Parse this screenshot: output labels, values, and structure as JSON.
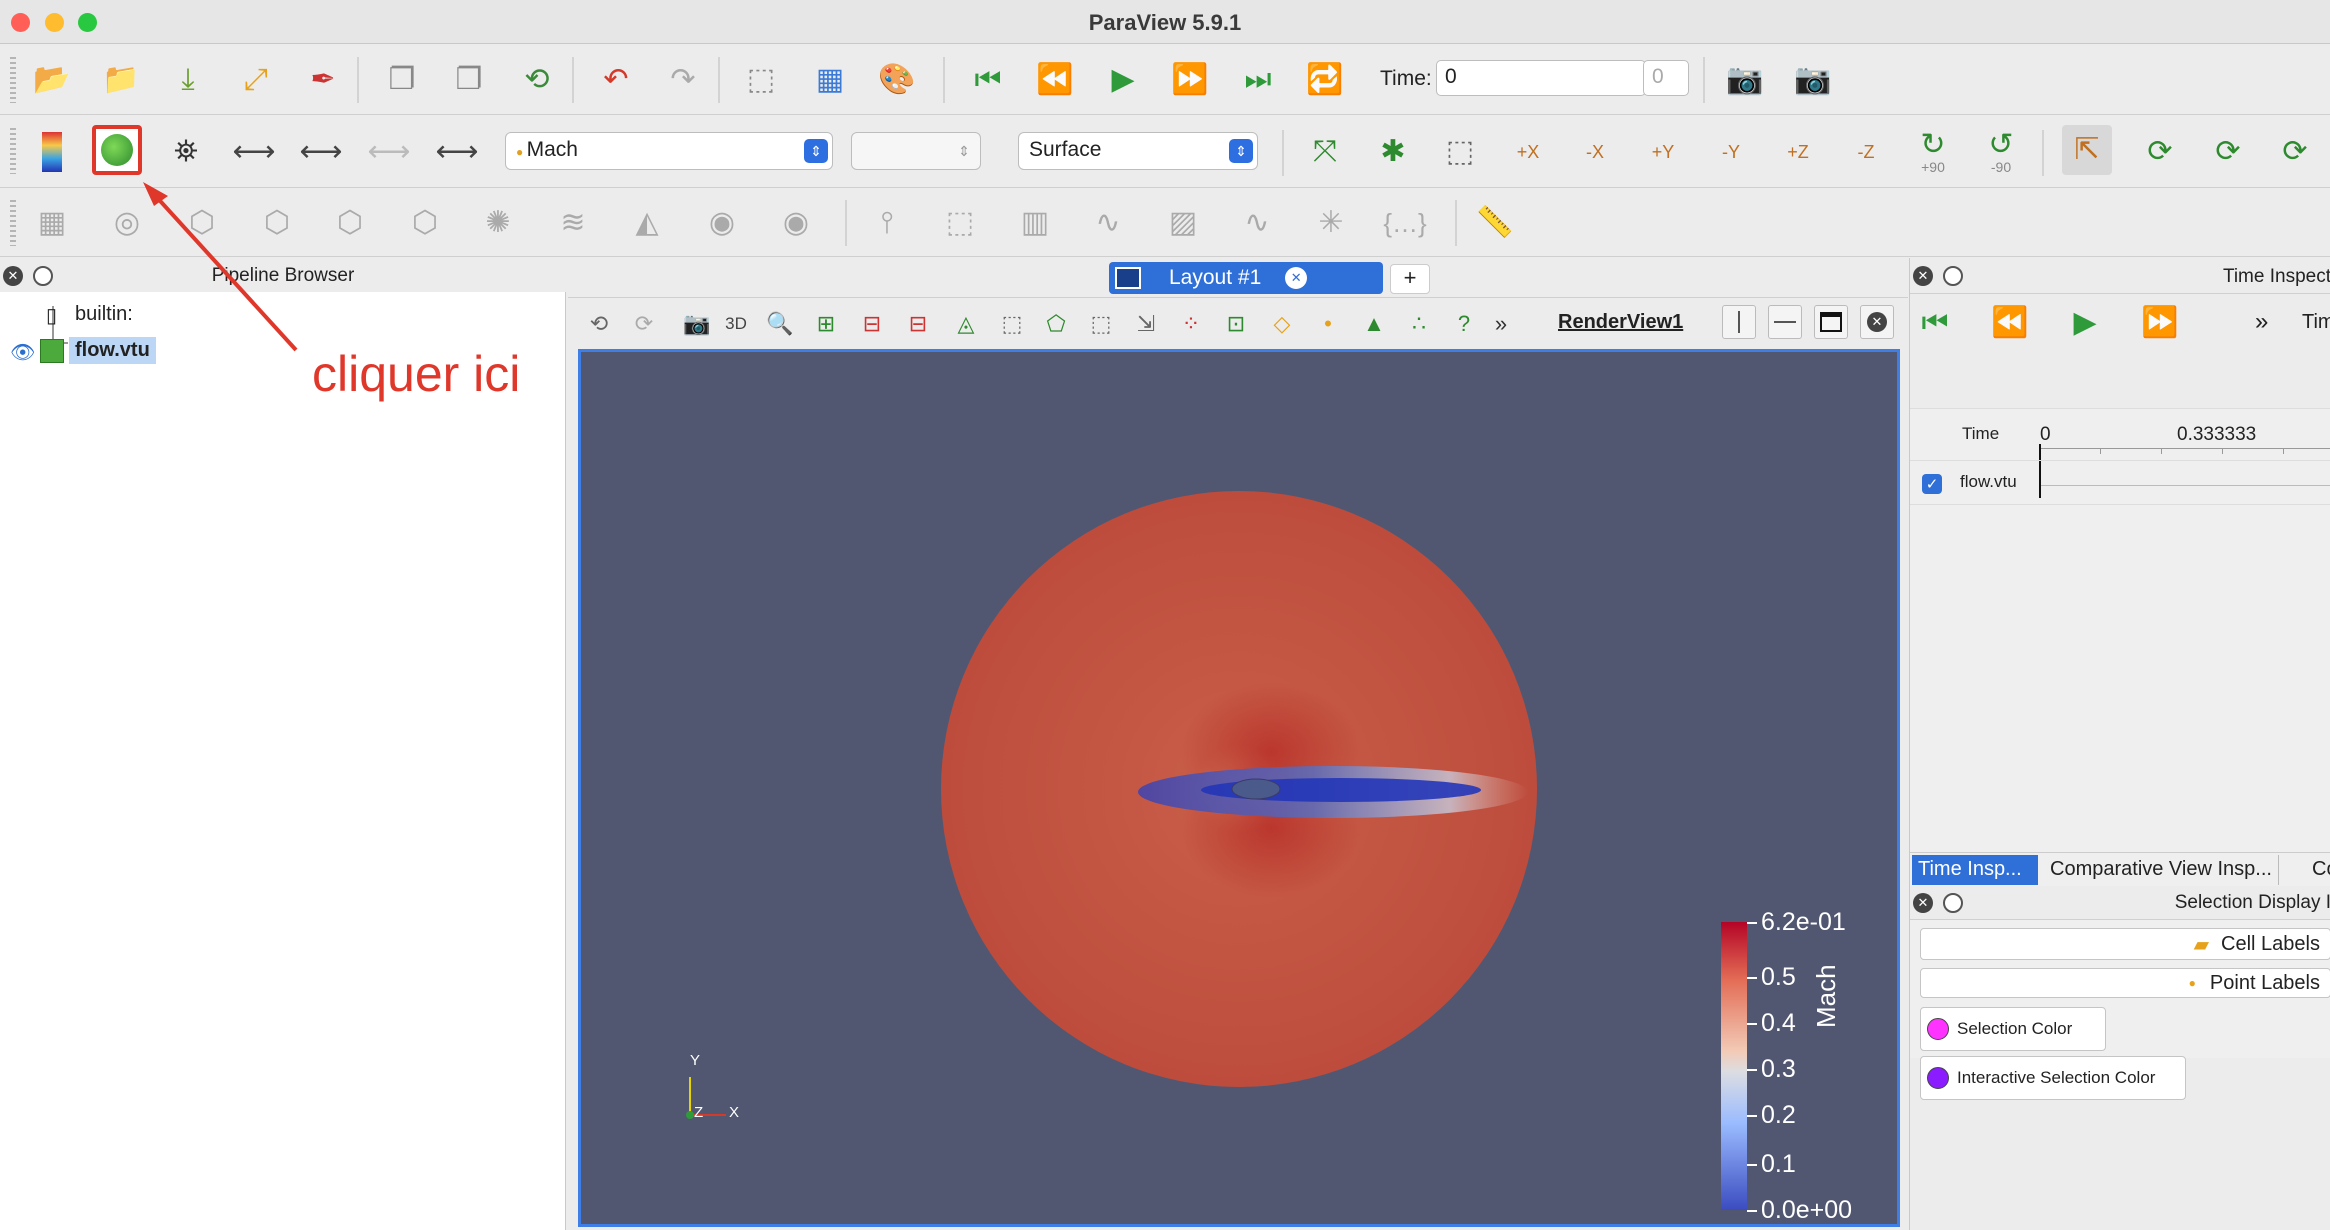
{
  "window": {
    "title": "ParaView 5.9.1"
  },
  "toolbar1": {
    "time_label": "Time:",
    "time_value": "0",
    "time_index": "0"
  },
  "toolbar2": {
    "array_select": "Mach",
    "component_select": "",
    "representation_select": "Surface",
    "cam_labels": [
      "+X",
      "-X",
      "+Y",
      "-Y",
      "+Z",
      "-Z"
    ],
    "rot_plus": "+90",
    "rot_minus": "-90"
  },
  "pipeline": {
    "title": "Pipeline Browser",
    "items": [
      {
        "label": "builtin:"
      },
      {
        "label": "flow.vtu"
      }
    ]
  },
  "annotation": {
    "text": "cliquer ici",
    "color": "#e0372b"
  },
  "layout": {
    "tab_label": "Layout #1",
    "add_label": "+",
    "view_name": "RenderView1",
    "btn_3d": "3D",
    "more": "»"
  },
  "render": {
    "background": "#525771",
    "axes": {
      "y": "Y",
      "z": "Z",
      "x": "X"
    },
    "colorbar": {
      "title": "Mach",
      "ticks": [
        "6.2e-01",
        "0.5",
        "0.4",
        "0.3",
        "0.2",
        "0.1",
        "0.0e+00"
      ]
    }
  },
  "time_inspector": {
    "title": "Time Inspect",
    "more": "»",
    "tim": "Tim",
    "time_header": "Time",
    "time_start": "0",
    "time_mid": "0.333333",
    "row_label": "flow.vtu",
    "row_checked": true
  },
  "tabs": [
    "Time Insp...",
    "Comparative View Insp...",
    "Co"
  ],
  "selection_display": {
    "title": "Selection Display I",
    "cell_labels": "Cell Labels",
    "point_labels": "Point Labels",
    "selection_color": "Selection Color",
    "interactive_selection_color": "Interactive Selection Color",
    "selection_swatch": "#ff33ff",
    "interactive_swatch": "#8a1cff"
  }
}
